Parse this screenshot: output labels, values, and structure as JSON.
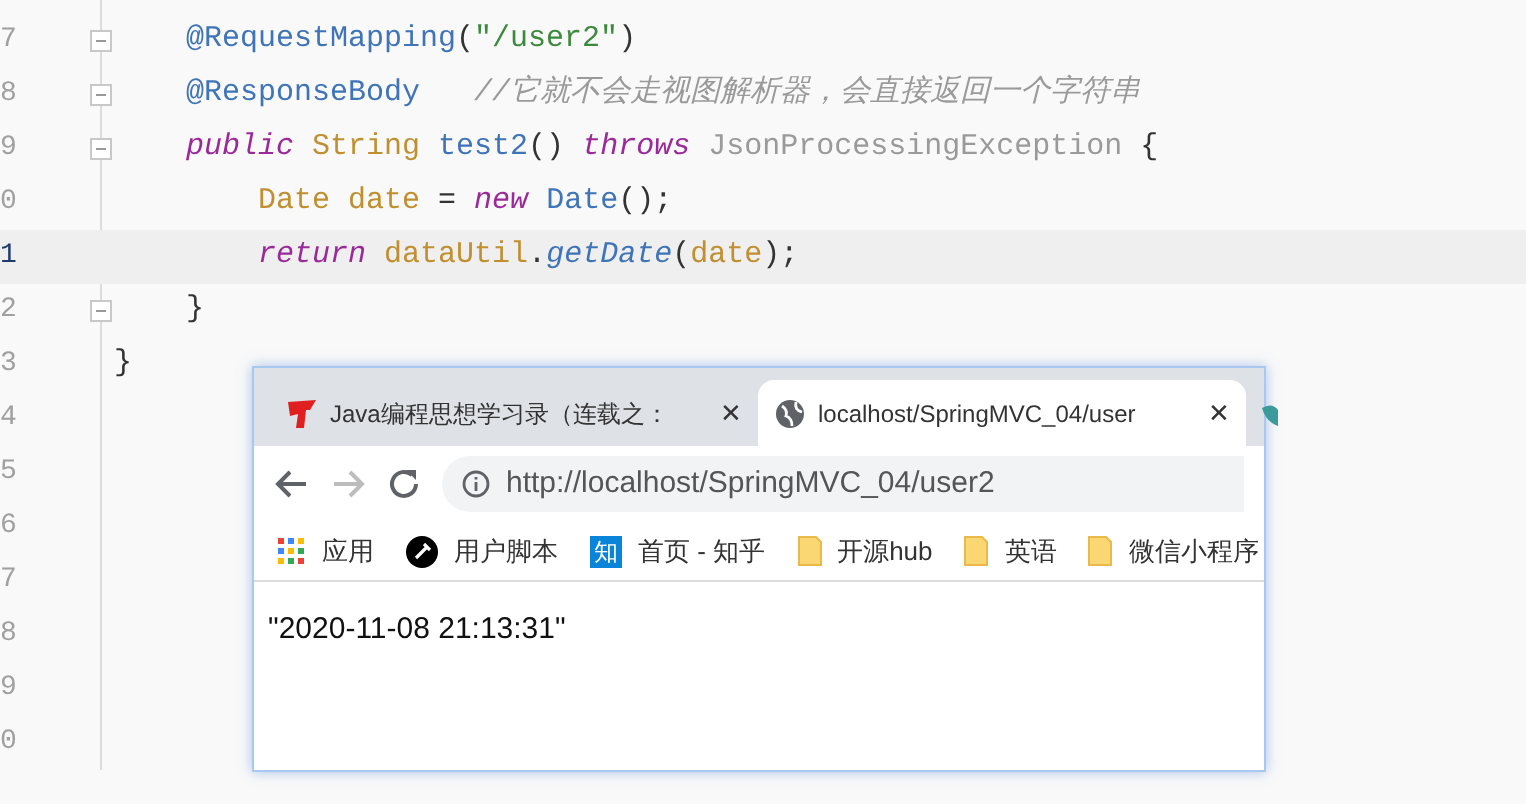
{
  "editor": {
    "lines": [
      {
        "number": "7",
        "fold": true,
        "current": false,
        "tokens": [
          {
            "kind": "annotation",
            "text": "    @RequestMapping"
          },
          {
            "kind": "plain",
            "text": "("
          },
          {
            "kind": "string",
            "text": "\"/user2\""
          },
          {
            "kind": "plain",
            "text": ")"
          }
        ]
      },
      {
        "number": "8",
        "fold": true,
        "current": false,
        "tokens": [
          {
            "kind": "annotation",
            "text": "    @ResponseBody"
          },
          {
            "kind": "comment",
            "text": "   //它就不会走视图解析器，会直接返回一个字符串"
          }
        ]
      },
      {
        "number": "9",
        "fold": true,
        "current": false,
        "tokens": [
          {
            "kind": "keyword",
            "text": "    public"
          },
          {
            "kind": "type",
            "text": " String"
          },
          {
            "kind": "method",
            "text": " test2"
          },
          {
            "kind": "plain",
            "text": "()"
          },
          {
            "kind": "keyword",
            "text": " throws"
          },
          {
            "kind": "unused",
            "text": " JsonProcessingException"
          },
          {
            "kind": "plain",
            "text": " {"
          }
        ]
      },
      {
        "number": "0",
        "fold": false,
        "current": false,
        "tokens": [
          {
            "kind": "type",
            "text": "        Date date"
          },
          {
            "kind": "plain",
            "text": " ="
          },
          {
            "kind": "keyword",
            "text": " new"
          },
          {
            "kind": "method",
            "text": " Date"
          },
          {
            "kind": "plain",
            "text": "();"
          }
        ]
      },
      {
        "number": "1",
        "fold": false,
        "current": true,
        "tokens": [
          {
            "kind": "keyword",
            "text": "        return"
          },
          {
            "kind": "type",
            "text": " dataUtil"
          },
          {
            "kind": "plain",
            "text": "."
          },
          {
            "kind": "call",
            "text": "getDate"
          },
          {
            "kind": "plain",
            "text": "("
          },
          {
            "kind": "type",
            "text": "date"
          },
          {
            "kind": "plain",
            "text": ");"
          }
        ]
      },
      {
        "number": "2",
        "fold": true,
        "current": false,
        "tokens": [
          {
            "kind": "plain",
            "text": "    }"
          }
        ]
      },
      {
        "number": "3",
        "fold": false,
        "current": false,
        "tokens": [
          {
            "kind": "plain",
            "text": "}"
          }
        ]
      },
      {
        "number": "4",
        "fold": false,
        "current": false
      },
      {
        "number": "5",
        "fold": false,
        "current": false
      },
      {
        "number": "6",
        "fold": false,
        "current": false
      },
      {
        "number": "7",
        "fold": false,
        "current": false
      },
      {
        "number": "8",
        "fold": false,
        "current": false
      },
      {
        "number": "9",
        "fold": false,
        "current": false
      },
      {
        "number": "0",
        "fold": false,
        "current": false
      }
    ]
  },
  "browser": {
    "tabs": [
      {
        "title": "Java编程思想学习录（连载之：",
        "selected": false,
        "close": "✕"
      },
      {
        "title": "localhost/SpringMVC_04/user",
        "selected": true,
        "close": "✕"
      }
    ],
    "address": "http://localhost/SpringMVC_04/user2",
    "forward_disabled": true,
    "bookmarks": [
      {
        "kind": "apps",
        "label": "应用"
      },
      {
        "kind": "script",
        "label": "用户脚本"
      },
      {
        "kind": "zhihu",
        "label": "首页 - 知乎",
        "badge": "知"
      },
      {
        "kind": "folder",
        "label": "开源hub"
      },
      {
        "kind": "folder",
        "label": "英语"
      },
      {
        "kind": "folder",
        "label": "微信小程序"
      }
    ],
    "content": "\"2020-11-08 21:13:31\""
  }
}
